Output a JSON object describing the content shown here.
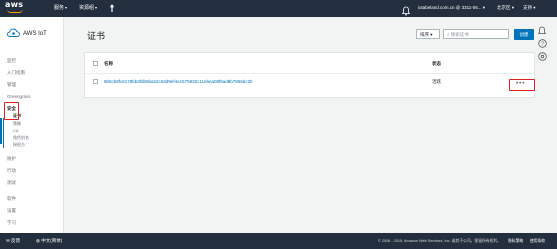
{
  "topnav": {
    "logo_text": "aws",
    "services_label": "服务",
    "resource_groups_label": "资源组",
    "account_label": "iotabeland.com.cn @ 3311-06...",
    "region_label": "北京区",
    "support_label": "支持"
  },
  "sidebar": {
    "brand": "AWS IoT",
    "items": [
      {
        "label": "监控"
      },
      {
        "label": "入门指南"
      },
      {
        "label": "管理"
      },
      {
        "label": "Greengrass"
      },
      {
        "label": "安全"
      },
      {
        "label": "测试"
      },
      {
        "label": "软件"
      },
      {
        "label": "设置"
      },
      {
        "label": "学习"
      }
    ],
    "security_sub": [
      {
        "label": "证书"
      },
      {
        "label": "策略"
      },
      {
        "label": "CA"
      },
      {
        "label": "角色别名"
      },
      {
        "label": "授权方"
      }
    ],
    "act_label": "行动",
    "defend_label": "防护"
  },
  "main": {
    "title": "证书",
    "sort_label": "排序",
    "search_placeholder": "搜索证书",
    "create_label": "创建",
    "table": {
      "col_name": "名称",
      "col_status": "状态",
      "rows": [
        {
          "name": "8b5cb8fc6178bb3fdb9ba22c63d9ef4e1575932c11ebea09f5ad8b7856bc2b",
          "status": "活跃"
        }
      ]
    }
  },
  "footer": {
    "feedback_label": "反馈",
    "language_label": "中文(简体)",
    "copyright": "© 2008 - 2019, Amazon Web Services, Inc. 或其子公司。保留所有权利。",
    "privacy_label": "隐私策略",
    "terms_label": "使用条款"
  },
  "colors": {
    "nav_bg": "#232f3e",
    "accent": "#0073bb",
    "highlight": "#e02020",
    "aws_orange": "#ff9900"
  }
}
